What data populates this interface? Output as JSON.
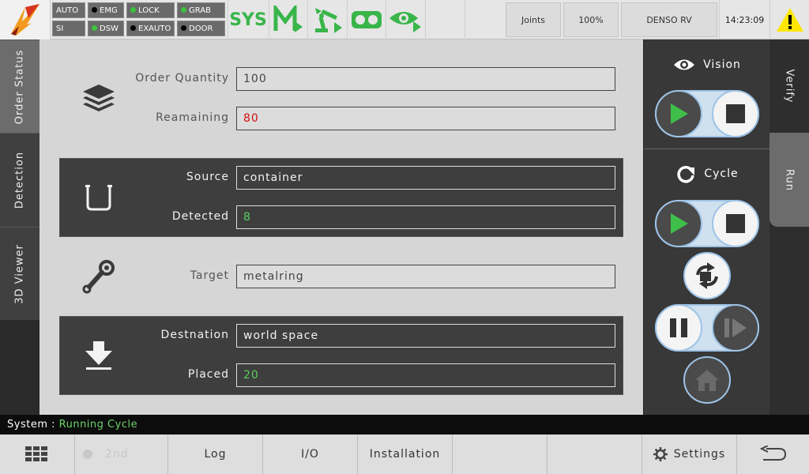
{
  "topbar": {
    "status": [
      {
        "top": {
          "label": "AUTO",
          "dot": null
        },
        "bottom": {
          "label": "SI",
          "dot": null
        }
      },
      {
        "top": {
          "label": "EMG",
          "dot": "#000000"
        },
        "bottom": {
          "label": "DSW",
          "dot": "#39c439"
        }
      },
      {
        "top": {
          "label": "LOCK",
          "dot": "#39c439"
        },
        "bottom": {
          "label": "EXAUTO",
          "dot": "#000000"
        }
      },
      {
        "top": {
          "label": "GRAB",
          "dot": "#39c439"
        },
        "bottom": {
          "label": "DOOR",
          "dot": "#000000"
        }
      }
    ],
    "sys_label": "SYS",
    "joints_label": "Joints",
    "speed_label": "100%",
    "robot_label": "DENSO RV",
    "clock": "14:23:09",
    "accent_green": "#39b54a"
  },
  "left_tabs": [
    {
      "label": "Order Status",
      "active": true
    },
    {
      "label": "Detection",
      "active": false
    },
    {
      "label": "3D Viewer",
      "active": false
    }
  ],
  "main": {
    "order_quantity": {
      "label": "Order Quantity",
      "value": "100"
    },
    "remaining": {
      "label": "Reamaining",
      "value": "80"
    },
    "source": {
      "label": "Source",
      "value": "container"
    },
    "detected": {
      "label": "Detected",
      "value": "8"
    },
    "target": {
      "label": "Target",
      "value": "metalring"
    },
    "destination": {
      "label": "Destnation",
      "value": "world space"
    },
    "placed": {
      "label": "Placed",
      "value": "20"
    }
  },
  "right_panel": {
    "vision_label": "Vision",
    "cycle_label": "Cycle"
  },
  "right_tabs": [
    {
      "label": "Verify",
      "active": false
    },
    {
      "label": "Run",
      "active": true
    }
  ],
  "status_line": {
    "prefix": "System :",
    "value": "Running Cycle"
  },
  "bottom_bar": {
    "second_label": "2nd",
    "log_label": "Log",
    "io_label": "I/O",
    "installation_label": "Installation",
    "settings_label": "Settings"
  }
}
